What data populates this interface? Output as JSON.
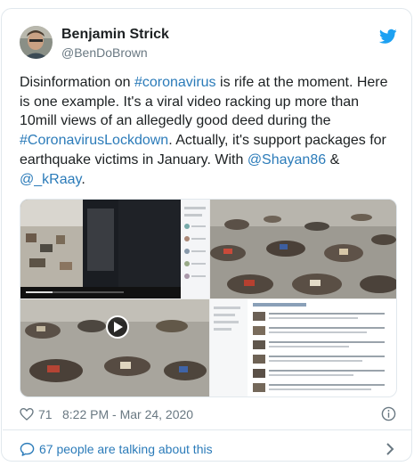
{
  "author": {
    "name": "Benjamin Strick",
    "handle": "@BenDoBrown"
  },
  "tweet": {
    "parts": [
      {
        "t": "Disinformation on "
      },
      {
        "t": "#coronavirus",
        "link": true
      },
      {
        "t": " is rife at the moment. Here is one example. It's a viral video racking up more than 10mill views of an allegedly good deed during the "
      },
      {
        "t": "#CoronavirusLockdown",
        "link": true
      },
      {
        "t": ". Actually, it's support packages for earthquake victims in January. With "
      },
      {
        "t": "@Shayan86",
        "link": true
      },
      {
        "t": " & "
      },
      {
        "t": "@_kRaay",
        "link": true
      },
      {
        "t": "."
      }
    ]
  },
  "footer": {
    "likes": "71",
    "timestamp": "8:22 PM - Mar 24, 2020",
    "talking": "67 people are talking about this"
  },
  "icons": {
    "logo": "twitter-bird-icon",
    "like": "heart-icon",
    "info": "info-icon",
    "conversation": "speech-bubble-icon",
    "expand": "chevron-right-icon",
    "video": "play-icon"
  },
  "colors": {
    "link": "#2b7bb9",
    "twitter_blue": "#1da1f2",
    "text": "#1c2022",
    "muted": "#697882",
    "border": "#e1e8ed"
  }
}
